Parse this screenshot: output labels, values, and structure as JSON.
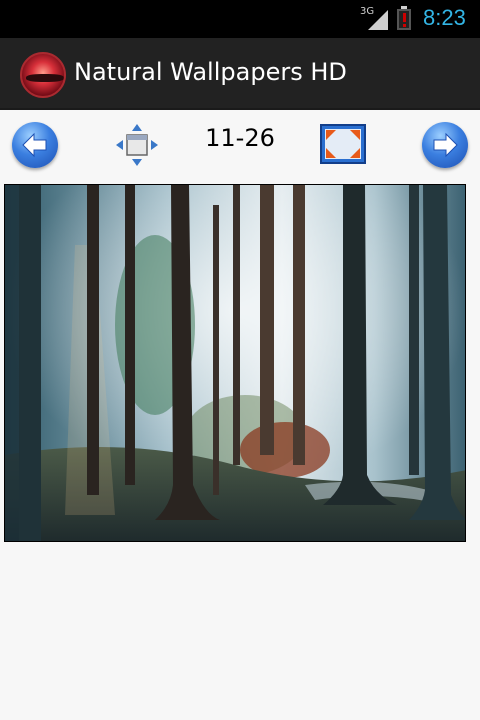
{
  "status_bar": {
    "network": "3G",
    "time": "8:23",
    "time_color": "#33b5e5",
    "battery_color": "#cc0000"
  },
  "action_bar": {
    "title": "Natural Wallpapers HD",
    "icon": "app-logo-icon"
  },
  "toolbar": {
    "counter": "11-26",
    "prev_icon": "arrow-left-icon",
    "next_icon": "arrow-right-icon",
    "resize_icon": "resize-icon",
    "fullscreen_icon": "fullscreen-icon"
  },
  "wallpaper": {
    "subject": "forest"
  }
}
